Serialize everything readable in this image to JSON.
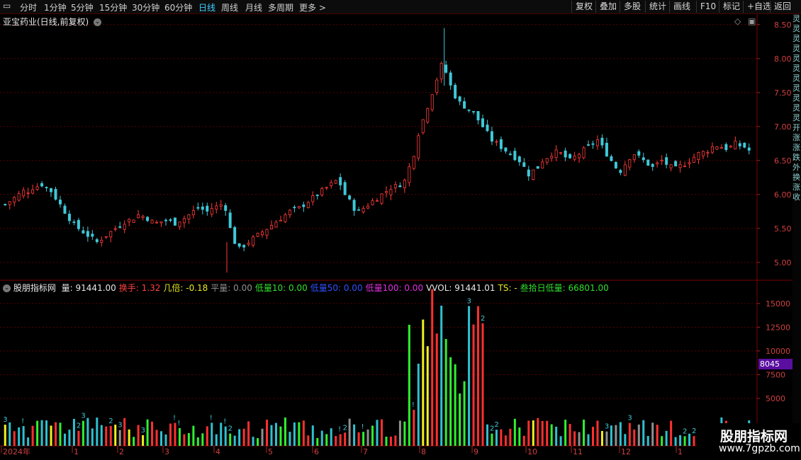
{
  "toolbar": {
    "periods": [
      "分时",
      "1分钟",
      "5分钟",
      "15分钟",
      "30分钟",
      "60分钟",
      "日线",
      "周线",
      "月线",
      "多周期",
      "更多 >"
    ],
    "active_period": "日线",
    "tools": [
      "复权",
      "叠加",
      "多股",
      "统计",
      "画线",
      "F10",
      "标记",
      "+自选",
      "返回"
    ]
  },
  "main_panel": {
    "title": "亚宝药业(日线,前复权)"
  },
  "indicator_panel": {
    "name": "股朋指标网",
    "readouts": [
      {
        "label": "量:",
        "value": "91441.00",
        "color": "#e8e8e8"
      },
      {
        "label": "换手:",
        "value": "1.32",
        "color": "#ff4040"
      },
      {
        "label": "几倍:",
        "value": "-0.18",
        "color": "#e8e820"
      },
      {
        "label": "平量:",
        "value": "0.00",
        "color": "#909090"
      },
      {
        "label": "低量10:",
        "value": "0.00",
        "color": "#30e030"
      },
      {
        "label": "低量50:",
        "value": "0.00",
        "color": "#3050ff"
      },
      {
        "label": "低量100:",
        "value": "0.00",
        "color": "#e030e0"
      },
      {
        "label": "VVOL:",
        "value": "91441.01",
        "color": "#e8e8e8"
      },
      {
        "label": "TS:",
        "value": "-",
        "color": "#e8e820"
      },
      {
        "label": "叁拾日低量:",
        "value": "66801.00",
        "color": "#30e030"
      }
    ],
    "current_value_label": "8045"
  },
  "watermark": {
    "line1": "股朋指标网",
    "line2": "www.7gpzb.com"
  },
  "right_strip": [
    "灵",
    "灵",
    "灵",
    "灵",
    "灵",
    "灵",
    "灵",
    "灵",
    "灵",
    "灵",
    "灵",
    "开",
    "涨",
    "涨",
    "跌",
    "外",
    "换",
    "涨",
    "收"
  ],
  "chart_data": [
    {
      "type": "candlestick",
      "title": "亚宝药业(日线,前复权)",
      "y_ticks": [
        "8.50",
        "8.00",
        "7.50",
        "7.00",
        "6.50",
        "6.00",
        "5.50",
        "5.00"
      ],
      "ylim": [
        4.8,
        8.55
      ],
      "grid": true,
      "x_tick_labels": [
        "2024年",
        "1",
        "2",
        "3",
        "4",
        "5",
        "6",
        "7",
        "8",
        "9",
        "10",
        "11",
        "12",
        "1"
      ],
      "close_series_approx": [
        5.85,
        5.9,
        5.95,
        6.0,
        6.05,
        6.05,
        6.1,
        6.12,
        6.15,
        6.1,
        6.05,
        5.95,
        5.85,
        5.75,
        5.65,
        5.55,
        5.5,
        5.45,
        5.4,
        5.35,
        5.3,
        5.35,
        5.4,
        5.45,
        5.5,
        5.55,
        5.6,
        5.62,
        5.65,
        5.7,
        5.68,
        5.65,
        5.6,
        5.58,
        5.6,
        5.62,
        5.6,
        5.58,
        5.62,
        5.65,
        5.7,
        5.75,
        5.8,
        5.78,
        5.75,
        5.8,
        5.82,
        5.85,
        5.8,
        5.5,
        5.3,
        5.2,
        5.25,
        5.3,
        5.35,
        5.4,
        5.45,
        5.5,
        5.55,
        5.6,
        5.65,
        5.7,
        5.75,
        5.78,
        5.8,
        5.85,
        5.9,
        5.95,
        6.0,
        6.05,
        6.1,
        6.15,
        6.2,
        6.15,
        6.0,
        5.9,
        5.8,
        5.75,
        5.8,
        5.85,
        5.9,
        5.95,
        6.0,
        6.05,
        6.1,
        6.12,
        6.15,
        6.2,
        6.4,
        6.6,
        6.9,
        7.1,
        7.3,
        7.5,
        7.7,
        7.9,
        7.8,
        7.6,
        7.45,
        7.35,
        7.3,
        7.25,
        7.2,
        7.1,
        7.0,
        6.9,
        6.8,
        6.75,
        6.7,
        6.65,
        6.6,
        6.55,
        6.5,
        6.4,
        6.3,
        6.35,
        6.4,
        6.5,
        6.55,
        6.6,
        6.62,
        6.6,
        6.55,
        6.5,
        6.55,
        6.6,
        6.65,
        6.7,
        6.75,
        6.8,
        6.7,
        6.6,
        6.5,
        6.4,
        6.35,
        6.45,
        6.55,
        6.6,
        6.55,
        6.5,
        6.45,
        6.4,
        6.45,
        6.5,
        6.45,
        6.4,
        6.38,
        6.42,
        6.45,
        6.5,
        6.55,
        6.6,
        6.62,
        6.65,
        6.7,
        6.72,
        6.7,
        6.68,
        6.7,
        6.75,
        6.72,
        6.7,
        6.65
      ]
    },
    {
      "type": "bar",
      "title": "股朋指标网",
      "y_ticks": [
        "15000",
        "12500",
        "10000",
        "7500",
        "5000"
      ],
      "ylim": [
        0,
        17000
      ],
      "grid": true,
      "colors": {
        "normal_up": "#ff3030",
        "normal_down": "#30c0d0",
        "low_10": "#30f030",
        "gray": "#909090",
        "yellow": "#f0f020",
        "blue": "#3050ff",
        "magenta": "#e030e0"
      },
      "markers": [
        "3",
        "2",
        "!"
      ]
    }
  ]
}
